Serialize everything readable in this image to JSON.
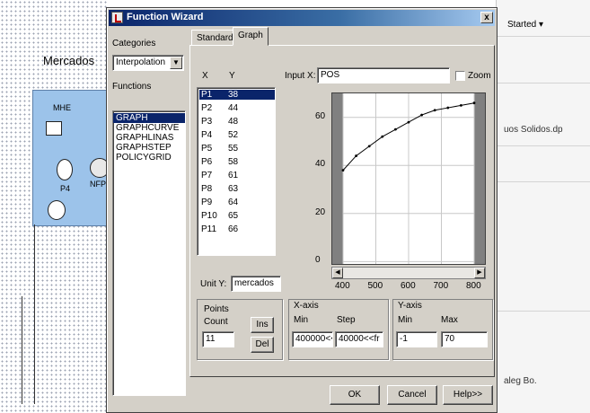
{
  "background": {
    "title": "Mercados",
    "nodes": [
      "MHE",
      "P4",
      "NFP"
    ],
    "right": {
      "menu": "Started",
      "file_label": "uos Solidos.dp",
      "dialog_label": "aleg Bo."
    }
  },
  "dialog": {
    "title": "Function Wizard",
    "close": "x",
    "categories_label": "Categories",
    "category_value": "Interpolation",
    "functions_label": "Functions",
    "functions": [
      "GRAPH",
      "GRAPHCURVE",
      "GRAPHLINAS",
      "GRAPHSTEP",
      "POLICYGRID"
    ],
    "selected_function": "GRAPH",
    "tabs": [
      "Standard",
      "Graph"
    ],
    "active_tab": "Graph",
    "xy_header": {
      "x": "X",
      "y": "Y"
    },
    "xy_rows": [
      {
        "x": "P1",
        "y": "38"
      },
      {
        "x": "P2",
        "y": "44"
      },
      {
        "x": "P3",
        "y": "48"
      },
      {
        "x": "P4",
        "y": "52"
      },
      {
        "x": "P5",
        "y": "55"
      },
      {
        "x": "P6",
        "y": "58"
      },
      {
        "x": "P7",
        "y": "61"
      },
      {
        "x": "P8",
        "y": "63"
      },
      {
        "x": "P9",
        "y": "64"
      },
      {
        "x": "P10",
        "y": "65"
      },
      {
        "x": "P11",
        "y": "66"
      }
    ],
    "input_x_label": "Input X:",
    "input_x_value": "POS",
    "zoom_label": "Zoom",
    "unit_y_label": "Unit Y:",
    "unit_y_value": "mercados",
    "points_label": "Points",
    "count_label": "Count",
    "count_value": "11",
    "ins_label": "Ins",
    "del_label": "Del",
    "xaxis_label": "X-axis",
    "x_min_label": "Min",
    "x_min_value": "400000<<",
    "x_step_label": "Step",
    "x_step_value": "40000<<fr",
    "yaxis_label": "Y-axis",
    "y_min_label": "Min",
    "y_min_value": "-1",
    "y_max_label": "Max",
    "y_max_value": "70",
    "ok_label": "OK",
    "cancel_label": "Cancel",
    "help_label": "Help>>"
  },
  "chart_data": {
    "type": "line",
    "x": [
      400,
      440,
      480,
      520,
      560,
      600,
      640,
      680,
      720,
      760,
      800
    ],
    "y": [
      38,
      44,
      48,
      52,
      55,
      58,
      61,
      63,
      64,
      65,
      66
    ],
    "xlim": [
      400,
      800
    ],
    "ylim": [
      -1,
      70
    ],
    "x_ticks": [
      "400",
      "500",
      "600",
      "700",
      "800"
    ],
    "y_ticks": [
      "60",
      "40",
      "20",
      "0"
    ],
    "grid": true,
    "line_color": "#000000",
    "band_color": "#808080"
  }
}
